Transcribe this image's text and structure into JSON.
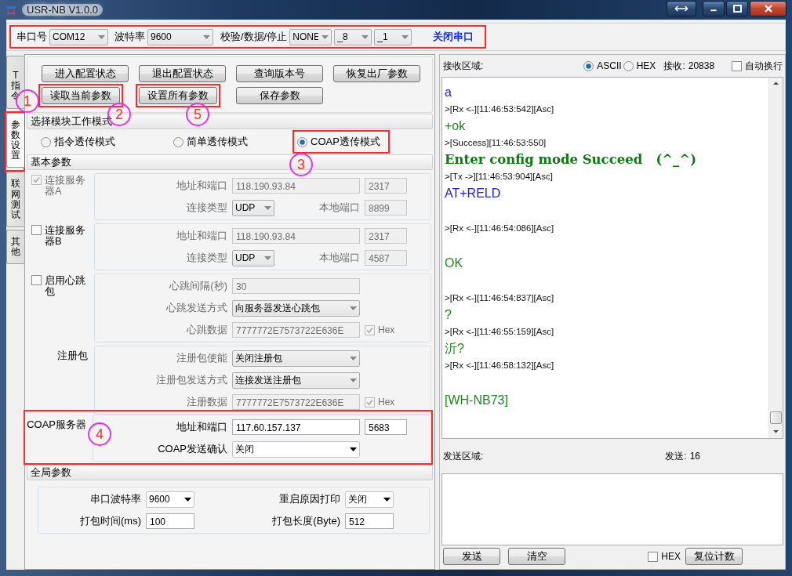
{
  "window": {
    "title": "USR-NB V1.0.0"
  },
  "serial_bar": {
    "highlighted": true,
    "fields": [
      {
        "label": "串口号",
        "value": "COM12"
      },
      {
        "label": "波特率",
        "value": "9600"
      },
      {
        "label": "校验/数据/停止",
        "value": "NONE"
      },
      {
        "value": "_8"
      },
      {
        "value": "_1"
      }
    ],
    "close_button": "关闭串口"
  },
  "side_tabs": [
    {
      "label": "T指令",
      "selected": false
    },
    {
      "label": "参数设置",
      "selected": true,
      "highlighted": true,
      "callout": "1"
    },
    {
      "label": "联网测试",
      "selected": false
    },
    {
      "label": "其他",
      "selected": false
    }
  ],
  "buttons": [
    {
      "label": "进入配置状态"
    },
    {
      "label": "退出配置状态"
    },
    {
      "label": "查询版本号"
    },
    {
      "label": "恢复出厂参数"
    },
    {
      "label": "读取当前参数",
      "highlighted": true,
      "callout": "2"
    },
    {
      "label": "设置所有参数",
      "highlighted": true,
      "callout": "5"
    },
    {
      "label": "保存参数"
    }
  ],
  "work_mode": {
    "title": "选择模块工作模式",
    "options": [
      {
        "label": "指令透传模式",
        "selected": false
      },
      {
        "label": "简单透传模式",
        "selected": false
      },
      {
        "label": "COAP透传模式",
        "selected": true,
        "highlighted": true,
        "callout": "3"
      }
    ]
  },
  "basic": {
    "title": "基本参数",
    "groups": [
      {
        "kind": "check",
        "label": "连接服务器A",
        "checked": true,
        "disabled": true,
        "fields_disabled": true,
        "rows": [
          {
            "label": "地址和端口",
            "main": [
              {
                "kind": "text",
                "value": "118.190.93.84",
                "disabled": true
              }
            ],
            "side": {
              "kind": "text",
              "value": "2317",
              "disabled": true
            }
          },
          {
            "label": "连接类型",
            "main": [
              {
                "kind": "list",
                "value": "UDP"
              },
              {
                "kind": "label",
                "text": "本地端口"
              }
            ],
            "side": {
              "kind": "text",
              "value": "8899",
              "disabled": true
            }
          }
        ]
      },
      {
        "kind": "check",
        "label": "连接服务器B",
        "checked": false,
        "disabled": false,
        "fields_disabled": true,
        "rows": [
          {
            "label": "地址和端口",
            "main": [
              {
                "kind": "text",
                "value": "118.190.93.84",
                "disabled": true
              }
            ],
            "side": {
              "kind": "text",
              "value": "2317",
              "disabled": true
            }
          },
          {
            "label": "连接类型",
            "main": [
              {
                "kind": "list",
                "value": "UDP"
              },
              {
                "kind": "label",
                "text": "本地端口"
              }
            ],
            "side": {
              "kind": "text",
              "value": "4587",
              "disabled": true
            }
          }
        ]
      },
      {
        "kind": "check",
        "label": "启用心跳包",
        "checked": false,
        "disabled": false,
        "fields_disabled": true,
        "rows": [
          {
            "label": "心跳间隔(秒)",
            "main": [
              {
                "kind": "text",
                "value": "30",
                "disabled": true
              }
            ]
          },
          {
            "label": "心跳发送方式",
            "main": [
              {
                "kind": "list",
                "value": "向服务器发送心跳包"
              }
            ]
          },
          {
            "label": "心跳数据",
            "main": [
              {
                "kind": "text",
                "value": "7777772E7573722E636E",
                "disabled": true
              }
            ],
            "side": {
              "kind": "check",
              "label": "Hex",
              "checked": true,
              "disabled": true
            }
          }
        ]
      },
      {
        "kind": "plain",
        "label": "注册包",
        "fields_disabled": true,
        "rows": [
          {
            "label": "注册包使能",
            "main": [
              {
                "kind": "list",
                "value": "关闭注册包"
              }
            ]
          },
          {
            "label": "注册包发送方式",
            "main": [
              {
                "kind": "list",
                "value": "连接发送注册包"
              }
            ]
          },
          {
            "label": "注册数据",
            "main": [
              {
                "kind": "text",
                "value": "7777772E7573722E636E",
                "disabled": true
              }
            ],
            "side": {
              "kind": "check",
              "label": "Hex",
              "checked": true,
              "disabled": true
            }
          }
        ]
      },
      {
        "kind": "plain",
        "label": "COAP服务器",
        "fields_disabled": false,
        "highlighted": true,
        "callout": "4",
        "rows": [
          {
            "label": "地址和端口",
            "main": [
              {
                "kind": "text",
                "value": "117.60.157.137",
                "disabled": false
              }
            ],
            "side": {
              "kind": "text",
              "value": "5683",
              "disabled": false
            }
          },
          {
            "label": "COAP发送确认",
            "main": [
              {
                "kind": "combo",
                "value": "关闭"
              }
            ]
          }
        ]
      }
    ]
  },
  "global": {
    "title": "全局参数",
    "rows": [
      [
        {
          "label": "串口波特率",
          "field": {
            "kind": "combo",
            "value": "9600"
          }
        },
        {
          "label": "重启原因打印",
          "field": {
            "kind": "combo",
            "value": "关闭"
          }
        }
      ],
      [
        {
          "label": "打包时间(ms)",
          "field": {
            "kind": "text",
            "value": "100",
            "disabled": false
          }
        },
        {
          "label": "打包长度(Byte)",
          "field": {
            "kind": "text",
            "value": "512",
            "disabled": false
          }
        }
      ]
    ]
  },
  "receive": {
    "title": "接收区域:",
    "formats": [
      {
        "label": "ASCII",
        "selected": true
      },
      {
        "label": "HEX",
        "selected": false
      }
    ],
    "count_label": "接收:",
    "count": "20838",
    "auto_wrap": {
      "label": "自动换行",
      "checked": false
    },
    "log": [
      {
        "kind": "tx",
        "text": "a"
      },
      {
        "kind": "meta",
        "text": ">[Rx <-][11:46:53:542][Asc]"
      },
      {
        "kind": "rx",
        "text": "+ok"
      },
      {
        "kind": "meta",
        "text": ">[Success][11:46:53:550]"
      },
      {
        "kind": "success",
        "text": "Enter config mode Succeed   (^_^)"
      },
      {
        "kind": "meta",
        "text": ">[Tx ->][11:46:53:904][Asc]"
      },
      {
        "kind": "tx",
        "text": "AT+RELD"
      },
      {
        "kind": "blank"
      },
      {
        "kind": "meta",
        "text": ">[Rx <-][11:46:54:086][Asc]"
      },
      {
        "kind": "blank"
      },
      {
        "kind": "rx",
        "text": "OK"
      },
      {
        "kind": "blank"
      },
      {
        "kind": "meta",
        "text": ">[Rx <-][11:46:54:837][Asc]"
      },
      {
        "kind": "rx",
        "text": "?"
      },
      {
        "kind": "meta",
        "text": ">[Rx <-][11:46:55:159][Asc]"
      },
      {
        "kind": "rx",
        "text": "沂?"
      },
      {
        "kind": "meta",
        "text": ">[Rx <-][11:46:58:132][Asc]"
      },
      {
        "kind": "blank"
      },
      {
        "kind": "rx",
        "text": "[WH-NB73]"
      }
    ]
  },
  "send": {
    "title": "发送区域:",
    "count_label": "发送:",
    "count": "16",
    "buttons": [
      "发送",
      "清空"
    ],
    "hex": {
      "label": "HEX",
      "checked": false
    },
    "reset_button": "复位计数"
  }
}
